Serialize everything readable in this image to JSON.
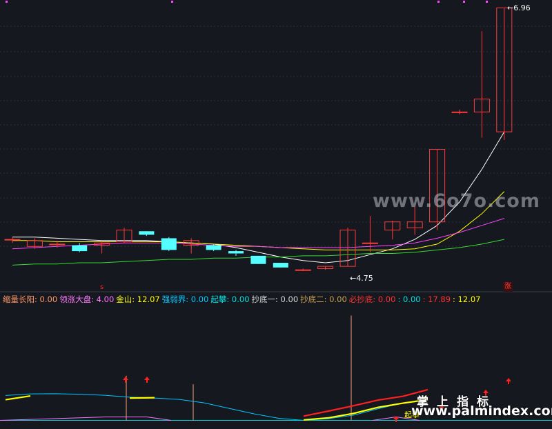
{
  "chart_data": [
    {
      "type": "candlestick",
      "panel": "main",
      "candles": [
        {
          "open": 4.98,
          "close": 4.98,
          "high": 5.0,
          "low": 4.95
        },
        {
          "open": 4.92,
          "close": 4.97,
          "high": 4.99,
          "low": 4.9
        },
        {
          "open": 4.94,
          "close": 4.94,
          "high": 4.97,
          "low": 4.91
        },
        {
          "open": 4.93,
          "close": 4.88,
          "high": 4.95,
          "low": 4.87
        },
        {
          "open": 4.93,
          "close": 4.95,
          "high": 4.96,
          "low": 4.86
        },
        {
          "open": 4.96,
          "close": 5.06,
          "high": 5.08,
          "low": 4.95
        },
        {
          "open": 5.05,
          "close": 5.02,
          "high": 5.05,
          "low": 5.01
        },
        {
          "open": 4.99,
          "close": 4.89,
          "high": 5.0,
          "low": 4.88
        },
        {
          "open": 4.93,
          "close": 4.97,
          "high": 4.99,
          "low": 4.86
        },
        {
          "open": 4.93,
          "close": 4.89,
          "high": 4.94,
          "low": 4.88
        },
        {
          "open": 4.88,
          "close": 4.86,
          "high": 4.89,
          "low": 4.84
        },
        {
          "open": 4.84,
          "close": 4.77,
          "high": 4.84,
          "low": 4.77
        },
        {
          "open": 4.78,
          "close": 4.74,
          "high": 4.78,
          "low": 4.74
        },
        {
          "open": 4.72,
          "close": 4.72,
          "high": 4.73,
          "low": 4.71
        },
        {
          "open": 4.73,
          "close": 4.75,
          "high": 4.75,
          "low": 4.72
        },
        {
          "open": 4.75,
          "close": 5.06,
          "high": 5.08,
          "low": 4.75
        },
        {
          "open": 4.95,
          "close": 4.95,
          "high": 5.18,
          "low": 4.87
        },
        {
          "open": 5.06,
          "close": 5.13,
          "high": 5.14,
          "low": 4.98
        },
        {
          "open": 5.08,
          "close": 5.13,
          "high": 5.26,
          "low": 5.02
        },
        {
          "open": 5.13,
          "close": 5.75,
          "high": 5.75,
          "low": 5.06
        },
        {
          "open": 6.07,
          "close": 6.07,
          "high": 6.09,
          "low": 6.05
        },
        {
          "open": 6.07,
          "close": 6.18,
          "high": 6.76,
          "low": 5.85
        },
        {
          "open": 5.9,
          "close": 6.96,
          "high": 6.96,
          "low": 5.83
        }
      ],
      "min_label": "←4.75",
      "max_label": "←6.96",
      "ylim": [
        4.68,
        6.98
      ],
      "moving_averages": [
        {
          "color": "#ffffff",
          "values": [
            5.0,
            5.0,
            4.99,
            4.98,
            4.97,
            4.97,
            4.97,
            4.96,
            4.95,
            4.94,
            4.91,
            4.87,
            4.83,
            4.8,
            4.78,
            4.8,
            4.85,
            4.9,
            4.98,
            5.1,
            5.3,
            5.58,
            5.9
          ]
        },
        {
          "color": "#ffff00",
          "values": [
            4.97,
            4.97,
            4.96,
            4.96,
            4.96,
            4.96,
            4.96,
            4.96,
            4.95,
            4.94,
            4.93,
            4.92,
            4.91,
            4.9,
            4.89,
            4.89,
            4.89,
            4.89,
            4.9,
            4.94,
            5.05,
            5.2,
            5.39
          ]
        },
        {
          "color": "#ff44ff",
          "values": [
            4.9,
            4.91,
            4.92,
            4.93,
            4.94,
            4.95,
            4.95,
            4.95,
            4.94,
            4.93,
            4.92,
            4.92,
            4.91,
            4.91,
            4.91,
            4.91,
            4.92,
            4.93,
            4.95,
            4.99,
            5.04,
            5.1,
            5.16
          ]
        },
        {
          "color": "#33dd33",
          "values": [
            4.76,
            4.77,
            4.77,
            4.78,
            4.78,
            4.79,
            4.8,
            4.81,
            4.81,
            4.82,
            4.82,
            4.83,
            4.83,
            4.84,
            4.84,
            4.85,
            4.86,
            4.86,
            4.87,
            4.89,
            4.91,
            4.94,
            4.98
          ]
        }
      ]
    },
    {
      "type": "line",
      "panel": "indicator",
      "legend": [
        {
          "label": "缩量长阳: 0.00",
          "color": "#ff9966"
        },
        {
          "label": "领涨大盘: 4.00",
          "color": "#ff77ff"
        },
        {
          "label": "金山: 12.07",
          "color": "#ffff00"
        },
        {
          "label": "强弱界: 0.00",
          "color": "#00c8ff"
        },
        {
          "label": "起攀: 0.00",
          "color": "#00e0e0"
        },
        {
          "label": "抄底一: 0.00",
          "color": "#d8d8d8"
        },
        {
          "label": "抄底二: 0.00",
          "color": "#c8a050"
        },
        {
          "label": "必抄底: 0.00",
          "color": "#ff3030"
        },
        {
          "label": ": 0.00",
          "color": "#00e0e0"
        },
        {
          "label": ": 17.89",
          "color": "#ff3030"
        },
        {
          "label": ": 12.07",
          "color": "#ffff00"
        }
      ],
      "series": [
        {
          "color": "#00c8ff",
          "values": [
            14.5,
            15.4,
            15.5,
            15.2,
            14.6,
            13.5,
            13.0,
            12.2,
            10.2,
            7.0,
            3.8,
            1.2,
            0.0,
            1.0,
            3.0,
            6.8,
            10.1,
            12.1
          ]
        },
        {
          "color": "#ffff00",
          "values": [
            12.0,
            14.2,
            null,
            null,
            null,
            13.0,
            13.2,
            null,
            null,
            null,
            null,
            null,
            0.3,
            1.5,
            4.0,
            7.6,
            10.0,
            12.07
          ]
        },
        {
          "color": "#ff2020",
          "values": [
            null,
            null,
            null,
            null,
            null,
            null,
            null,
            null,
            null,
            null,
            null,
            null,
            2.5,
            5.4,
            8.5,
            11.8,
            14.0,
            17.89
          ]
        }
      ],
      "spikes": [
        {
          "color": "#ffa07a",
          "value": 26
        },
        {
          "color": "#ffa07a",
          "value": 21
        },
        {
          "color": "#ffa07a",
          "value": 61
        }
      ],
      "arrows": 6,
      "arrow_label": "起攀",
      "badge": "涨",
      "marker": "s",
      "ylim": [
        -1,
        64
      ]
    }
  ],
  "watermarks": {
    "top": "www.6o7o.com",
    "bottom_cn": "掌上指标",
    "bottom_url": "www.palmindex.com"
  },
  "colors": {
    "background": "#16181f",
    "up": "#ff3b3b",
    "down": "#55ffff",
    "grid": "#2a2f3a"
  }
}
